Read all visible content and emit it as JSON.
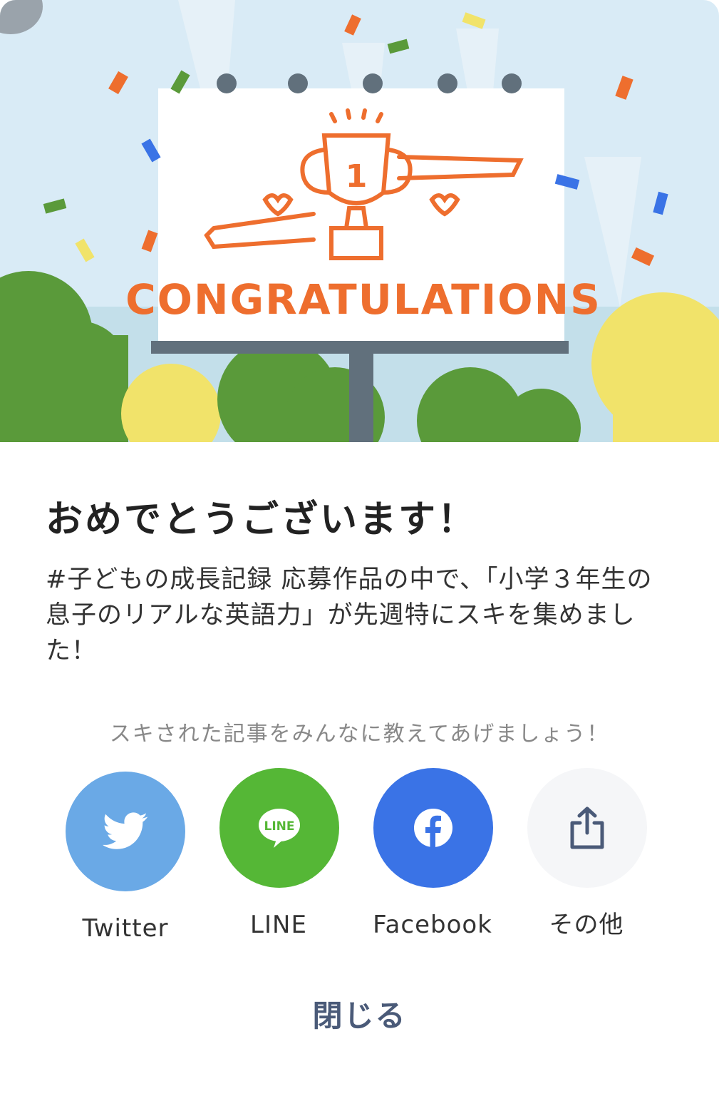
{
  "hero": {
    "billboard_text": "CONGRATULATIONS",
    "trophy_number": "1",
    "colors": {
      "sky": "#d9ebf6",
      "orange": "#ee6e2e",
      "green": "#5a9a3a",
      "yellow": "#f1e36a",
      "pole": "#61707c"
    }
  },
  "modal": {
    "title": "おめでとうございます！",
    "message": "#子どもの成長記録 応募作品の中で、「小学３年生の息子のリアルな英語力」が先週特にスキを集めました！",
    "share_prompt": "スキされた記事をみんなに教えてあげましょう！",
    "share_buttons": [
      {
        "label": "Twitter",
        "icon": "twitter-bird-icon",
        "color": "#6aa9e6"
      },
      {
        "label": "LINE",
        "icon": "line-logo-icon",
        "icon_text": "LINE",
        "color": "#55b736"
      },
      {
        "label": "Facebook",
        "icon": "facebook-f-icon",
        "color": "#3a73e6"
      },
      {
        "label": "その他",
        "icon": "share-upload-icon",
        "color": "#f5f6f8"
      }
    ],
    "close_label": "閉じる"
  }
}
